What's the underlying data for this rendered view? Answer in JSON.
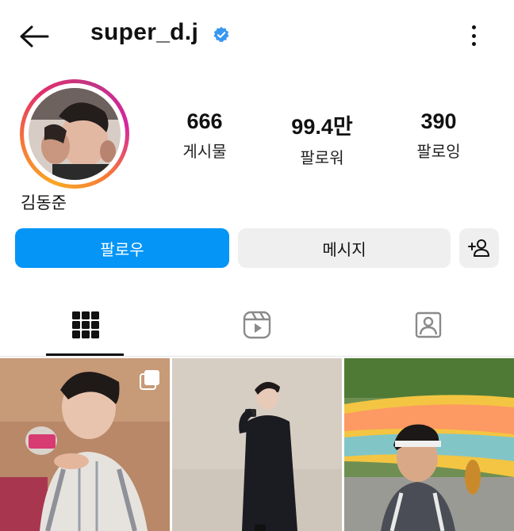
{
  "header": {
    "username": "super_d.j",
    "verified_icon": "verified-badge-icon",
    "back_icon": "arrow-left-icon",
    "more_icon": "more-vertical-icon"
  },
  "profile": {
    "display_name": "김동준",
    "stats": [
      {
        "value": "666",
        "label": "게시물"
      },
      {
        "value": "99.4만",
        "label": "팔로워"
      },
      {
        "value": "390",
        "label": "팔로잉"
      }
    ]
  },
  "actions": {
    "follow_label": "팔로우",
    "message_label": "메시지",
    "add_user_icon": "person-add-icon"
  },
  "tabs": [
    {
      "icon": "grid-icon",
      "active": true
    },
    {
      "icon": "reels-icon",
      "active": false
    },
    {
      "icon": "tagged-icon",
      "active": false
    }
  ],
  "posts": [
    {
      "icon": "multi-post-icon"
    },
    {},
    {}
  ],
  "colors": {
    "accent": "#0495f6",
    "verified": "#3897f0",
    "button_bg": "#efefef"
  }
}
